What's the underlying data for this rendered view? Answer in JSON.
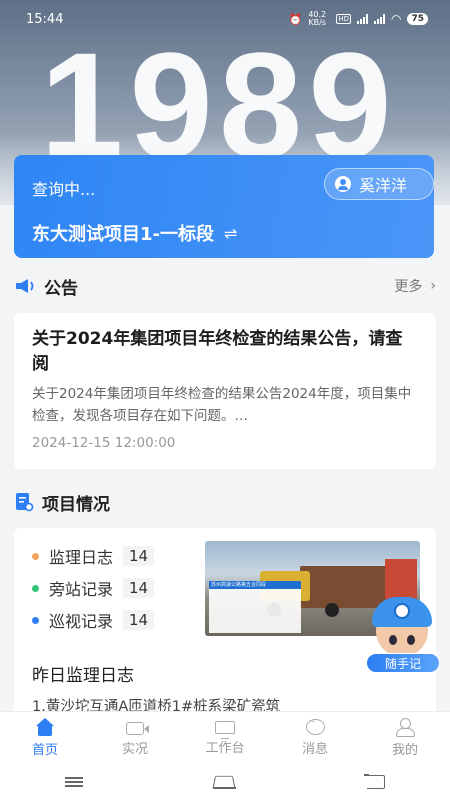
{
  "status_bar": {
    "time": "15:44",
    "network_speed": "40.2 KB/s",
    "battery": "75"
  },
  "hero": {
    "big_number": "1989"
  },
  "project_card": {
    "query_status": "查询中...",
    "user_name": "奚洋洋",
    "project_name": "东大测试项目1-一标段",
    "swap_icon": "swap-icon"
  },
  "notice": {
    "section_title": "公告",
    "more_label": "更多",
    "item": {
      "title": "关于2024年集团项目年终检查的结果公告，请查阅",
      "summary": "关于2024年集团项目年终检查的结果公告2024年度，项目集中检查，发现各项目存在如下问题。…",
      "time": "2024-12-15 12:00:00"
    }
  },
  "project_status": {
    "section_title": "项目情况",
    "stats": [
      {
        "label": "监理日志",
        "count": "14",
        "color": "#f5a25d"
      },
      {
        "label": "旁站记录",
        "count": "14",
        "color": "#33c27c"
      },
      {
        "label": "巡视记录",
        "count": "14",
        "color": "#2d7df3"
      }
    ],
    "photo_stamp_title": "苏州高速公路第五合同段",
    "yesterday_title": "昨日监理日志",
    "yesterday_item": "1.黄沙坨互通A匝道桥1#桩系梁矿瓷筑"
  },
  "assistant": {
    "label": "随手记"
  },
  "tabbar": {
    "tabs": [
      {
        "label": "首页",
        "icon": "home-icon",
        "active": true
      },
      {
        "label": "实况",
        "icon": "camera-icon",
        "active": false
      },
      {
        "label": "工作台",
        "icon": "desk-icon",
        "active": false
      },
      {
        "label": "消息",
        "icon": "message-icon",
        "active": false
      },
      {
        "label": "我的",
        "icon": "profile-icon",
        "active": false
      }
    ]
  },
  "colors": {
    "accent": "#2d7df3",
    "card_blue": "#3f8ff6"
  }
}
